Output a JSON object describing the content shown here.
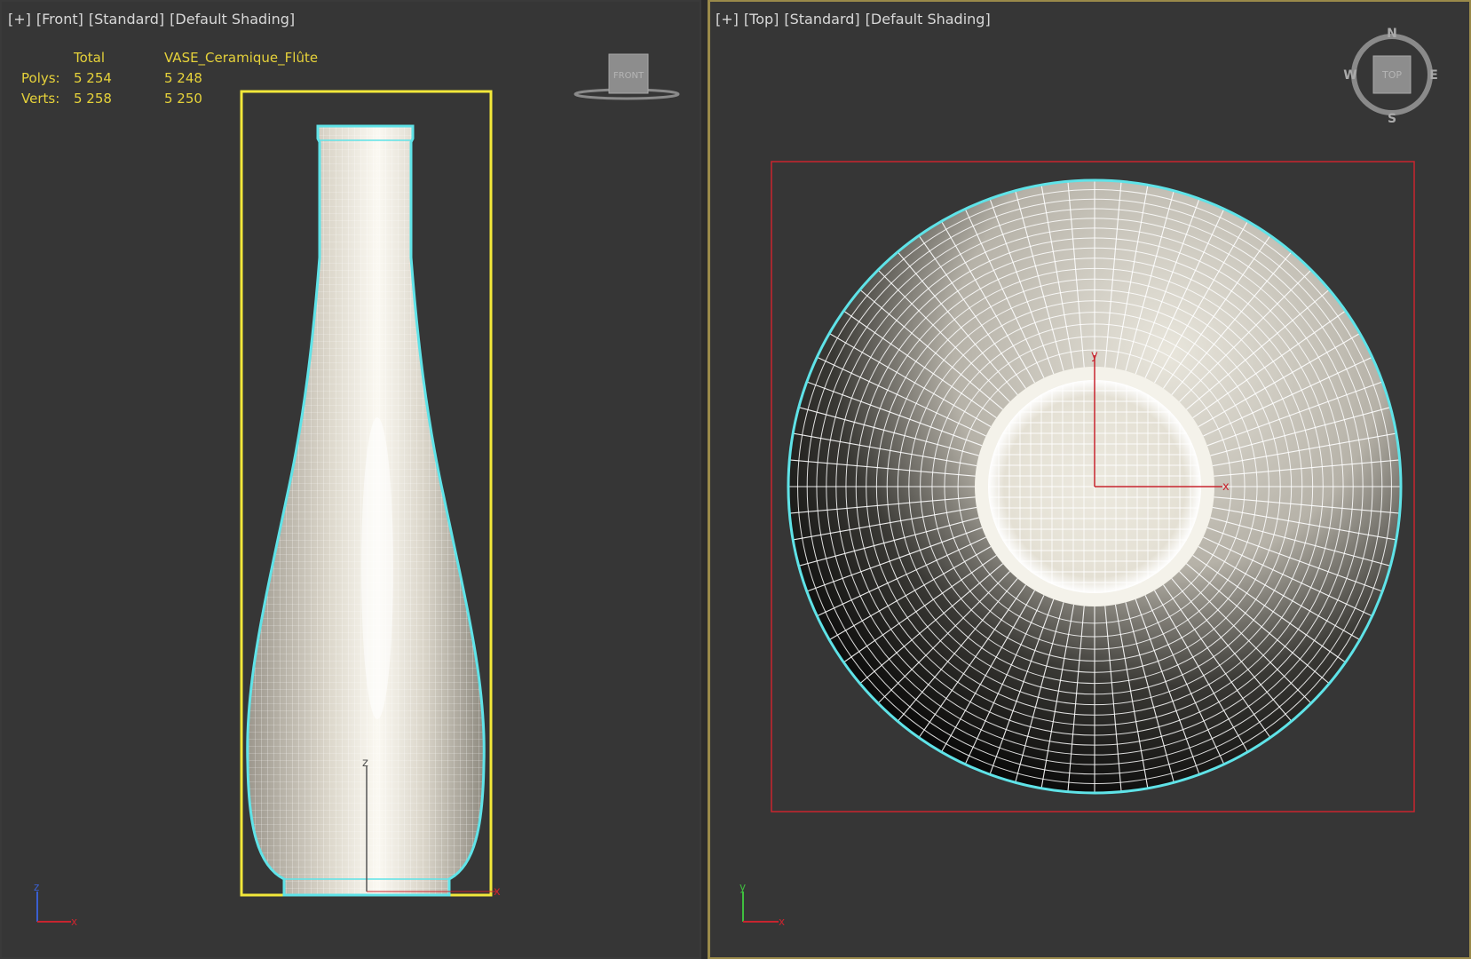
{
  "front_viewport": {
    "labels": [
      "[+]",
      "[Front]",
      "[Standard]",
      "[Default Shading]"
    ],
    "stats": {
      "col_total": "Total",
      "col_object": "VASE_Ceramique_Flûte",
      "rows": [
        {
          "label": "Polys:",
          "total": "5 254",
          "object": "5 248"
        },
        {
          "label": "Verts:",
          "total": "5 258",
          "object": "5 250"
        }
      ]
    },
    "viewcube_label": "FRONT",
    "gizmo_axes": {
      "z": "z",
      "x": "x"
    },
    "corner_axes": {
      "up": "z",
      "right": "x"
    }
  },
  "top_viewport": {
    "labels": [
      "[+]",
      "[Top]",
      "[Standard]",
      "[Default Shading]"
    ],
    "viewcube_label": "TOP",
    "compass": {
      "n": "N",
      "s": "S",
      "e": "E",
      "w": "W"
    },
    "gizmo_axes": {
      "y": "y",
      "x": "x"
    },
    "corner_axes": {
      "up": "y",
      "right": "x"
    }
  },
  "colors": {
    "viewport_bg": "#363636",
    "active_border": "#9a8a4a",
    "selection_outline": "#5fe3e8",
    "bbox_selected": "#f2e83a",
    "bbox_top": "#c8252f",
    "stats_text": "#e6d23a"
  }
}
